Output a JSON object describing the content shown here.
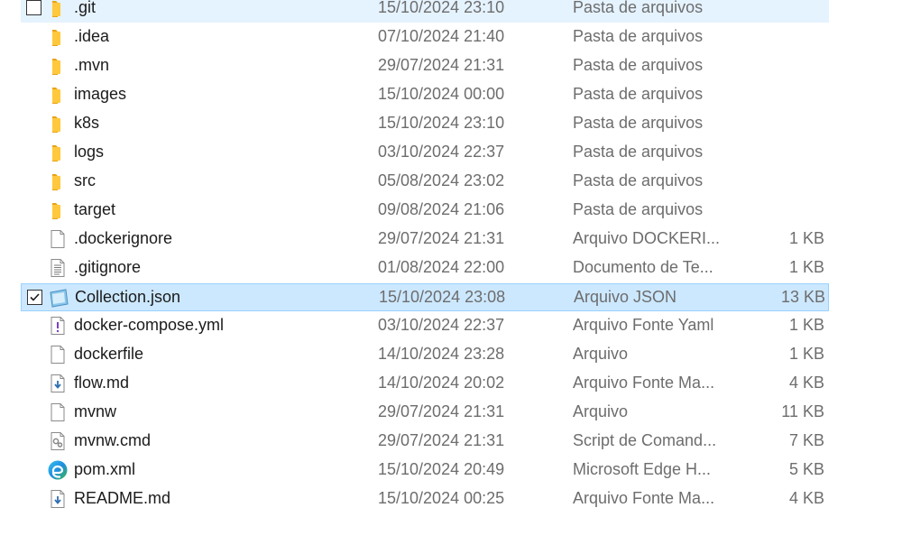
{
  "files": [
    {
      "name": ".git",
      "date": "15/10/2024 23:10",
      "type": "Pasta de arquivos",
      "size": "",
      "icon": "folder-icon",
      "checked": false,
      "state": "hover"
    },
    {
      "name": ".idea",
      "date": "07/10/2024 21:40",
      "type": "Pasta de arquivos",
      "size": "",
      "icon": "folder-icon"
    },
    {
      "name": ".mvn",
      "date": "29/07/2024 21:31",
      "type": "Pasta de arquivos",
      "size": "",
      "icon": "folder-icon"
    },
    {
      "name": "images",
      "date": "15/10/2024 00:00",
      "type": "Pasta de arquivos",
      "size": "",
      "icon": "folder-icon"
    },
    {
      "name": "k8s",
      "date": "15/10/2024 23:10",
      "type": "Pasta de arquivos",
      "size": "",
      "icon": "folder-icon"
    },
    {
      "name": "logs",
      "date": "03/10/2024 22:37",
      "type": "Pasta de arquivos",
      "size": "",
      "icon": "folder-icon"
    },
    {
      "name": "src",
      "date": "05/08/2024 23:02",
      "type": "Pasta de arquivos",
      "size": "",
      "icon": "folder-icon"
    },
    {
      "name": "target",
      "date": "09/08/2024 21:06",
      "type": "Pasta de arquivos",
      "size": "",
      "icon": "folder-icon"
    },
    {
      "name": ".dockerignore",
      "date": "29/07/2024 21:31",
      "type": "Arquivo DOCKERI...",
      "size": "1 KB",
      "icon": "blank-file-icon"
    },
    {
      "name": ".gitignore",
      "date": "01/08/2024 22:00",
      "type": "Documento de Te...",
      "size": "1 KB",
      "icon": "text-file-icon"
    },
    {
      "name": "Collection.json",
      "date": "15/10/2024 23:08",
      "type": "Arquivo JSON",
      "size": "13 KB",
      "icon": "json-file-icon",
      "checked": true,
      "state": "selected"
    },
    {
      "name": "docker-compose.yml",
      "date": "03/10/2024 22:37",
      "type": "Arquivo Fonte Yaml",
      "size": "1 KB",
      "icon": "yaml-file-icon"
    },
    {
      "name": "dockerfile",
      "date": "14/10/2024 23:28",
      "type": "Arquivo",
      "size": "1 KB",
      "icon": "blank-file-icon"
    },
    {
      "name": "flow.md",
      "date": "14/10/2024 20:02",
      "type": "Arquivo Fonte Ma...",
      "size": "4 KB",
      "icon": "markdown-file-icon"
    },
    {
      "name": "mvnw",
      "date": "29/07/2024 21:31",
      "type": "Arquivo",
      "size": "11 KB",
      "icon": "blank-file-icon"
    },
    {
      "name": "mvnw.cmd",
      "date": "29/07/2024 21:31",
      "type": "Script de Comand...",
      "size": "7 KB",
      "icon": "cmd-script-icon"
    },
    {
      "name": "pom.xml",
      "date": "15/10/2024 20:49",
      "type": "Microsoft Edge H...",
      "size": "5 KB",
      "icon": "edge-icon"
    },
    {
      "name": "README.md",
      "date": "15/10/2024 00:25",
      "type": "Arquivo Fonte Ma...",
      "size": "4 KB",
      "icon": "markdown-file-icon"
    }
  ],
  "colors": {
    "selection_bg": "#cce8ff",
    "selection_border": "#99d1ff",
    "hover_bg": "#e5f3ff",
    "folder": "#ffc83d",
    "secondary_text": "#6d6d6d"
  }
}
